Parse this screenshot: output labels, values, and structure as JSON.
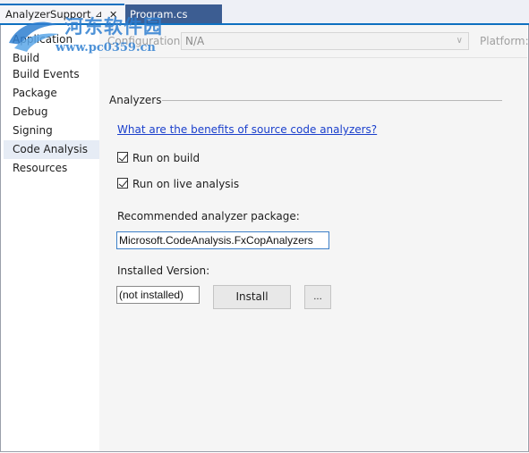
{
  "tabs": {
    "active": {
      "title": "AnalyzerSupport",
      "pin_glyph": "⊿",
      "close_glyph": "✕"
    },
    "inactive": {
      "title": "Program.cs"
    }
  },
  "nav": {
    "items": [
      {
        "label": "Application",
        "selected": false
      },
      {
        "label": "Build",
        "selected": false
      },
      {
        "label": "Build Events",
        "selected": false
      },
      {
        "label": "Package",
        "selected": false
      },
      {
        "label": "Debug",
        "selected": false
      },
      {
        "label": "Signing",
        "selected": false
      },
      {
        "label": "Code Analysis",
        "selected": true
      },
      {
        "label": "Resources",
        "selected": false
      }
    ]
  },
  "config": {
    "configuration_label": "Configuration:",
    "configuration_value": "N/A",
    "platform_label": "Platform:"
  },
  "analyzers": {
    "section_title": "Analyzers",
    "benefits_link": "What are the benefits of source code analyzers?",
    "run_on_build": {
      "label": "Run on build",
      "checked": true
    },
    "run_on_live": {
      "label": "Run on live analysis",
      "checked": true
    },
    "recommended_label": "Recommended analyzer package:",
    "package_value": "Microsoft.CodeAnalysis.FxCopAnalyzers",
    "installed_label": "Installed Version:",
    "installed_value": "(not installed)",
    "install_button": "Install",
    "more_button": "..."
  },
  "watermark": {
    "site_name": "河东软件园",
    "url": "www.pc0359.cn"
  },
  "colors": {
    "accent": "#0e70c0",
    "link": "#1a3fcc",
    "watermark": "#2f7fd1",
    "inactive_tab": "#3c5d92"
  }
}
